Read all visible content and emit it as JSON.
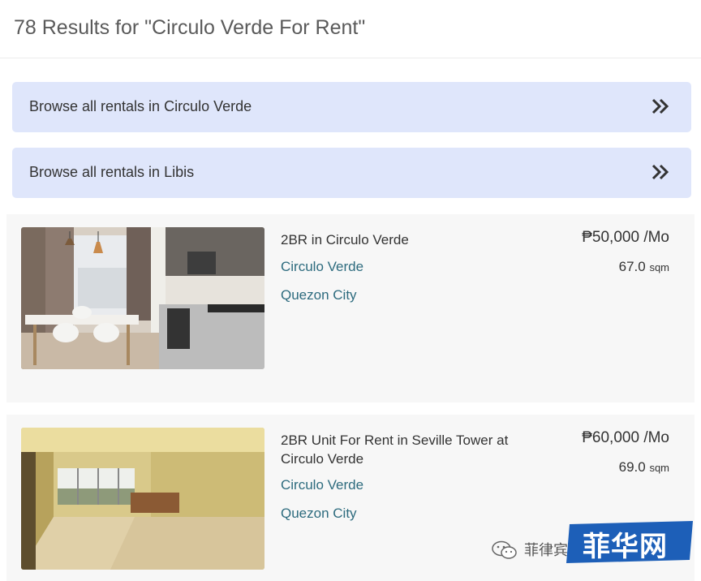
{
  "header": {
    "results_title": "78 Results for \"Circulo Verde For Rent\""
  },
  "browse_links": [
    {
      "label": "Browse all rentals in Circulo Verde"
    },
    {
      "label": "Browse all rentals in Libis"
    }
  ],
  "listings": [
    {
      "title": "2BR in Circulo Verde",
      "development": "Circulo Verde",
      "city": "Quezon City",
      "price": "₱50,000 /Mo",
      "area_value": "67.0",
      "area_unit": "sqm"
    },
    {
      "title": "2BR Unit For Rent in Seville Tower at Circulo Verde",
      "development": "Circulo Verde",
      "city": "Quezon City",
      "price": "₱60,000 /Mo",
      "area_value": "69.0",
      "area_unit": "sqm"
    }
  ],
  "watermark": {
    "text": "菲律宾",
    "logo_text": "菲华网"
  },
  "colors": {
    "browse_bg": "#dfe6fb",
    "link": "#2d6b7e",
    "listing_bg": "#f7f7f7",
    "logo_bg": "#1d5fb8"
  },
  "icons": {
    "browse_arrow": "double-chevron-right-icon",
    "watermark": "wechat-icon"
  }
}
